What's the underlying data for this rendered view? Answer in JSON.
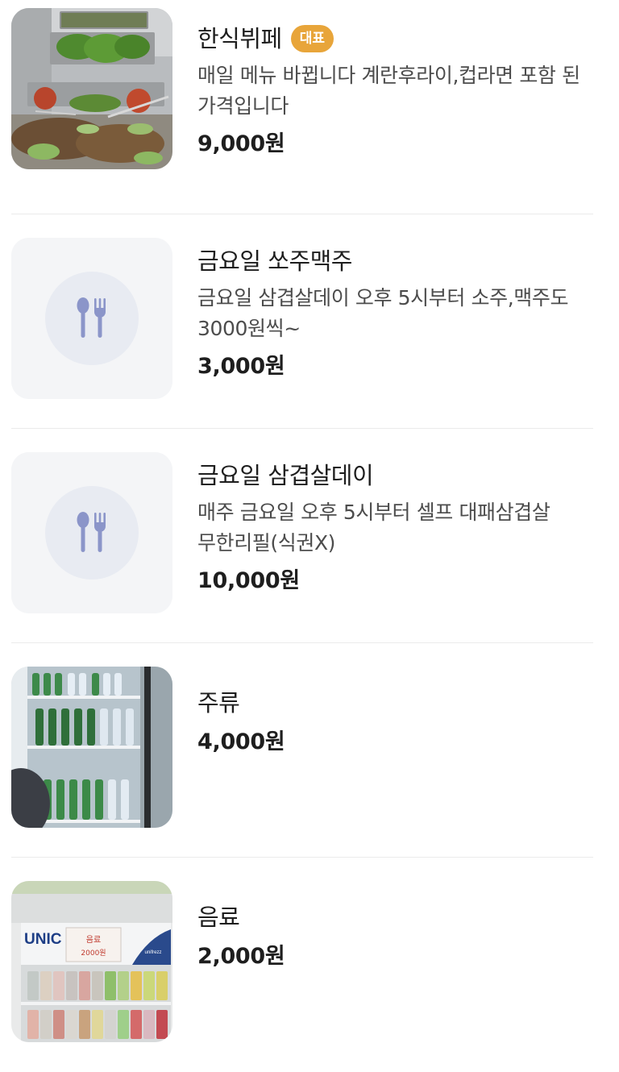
{
  "colors": {
    "badge": "#e8a53a",
    "placeholder_bg": "#f4f5f7",
    "placeholder_circle": "#e8ebf2",
    "placeholder_icon": "#8b95c9",
    "divider": "#ebebeb",
    "price_text": "#1e1e1e",
    "desc_text": "#4c4c4c"
  },
  "menu": {
    "items": [
      {
        "name": "한식뷔페",
        "badge": "대표",
        "description": "매일 메뉴 바뀝니다 계란후라이,컵라면 포함 된 가격입니다",
        "price": "9,000원",
        "image": "buffet-photo"
      },
      {
        "name": "금요일 쏘주맥주",
        "description": "금요일 삼겹살데이 오후 5시부터 소주,맥주도 3000원씩~",
        "price": "3,000원",
        "image": "utensils-placeholder-icon"
      },
      {
        "name": "금요일 삼겹살데이",
        "description": "매주 금요일 오후 5시부터 셀프 대패삼겹살 무한리필(식권X)",
        "price": "10,000원",
        "image": "utensils-placeholder-icon"
      },
      {
        "name": "주류",
        "price": "4,000원",
        "image": "liquor-fridge-photo"
      },
      {
        "name": "음료",
        "price": "2,000원",
        "image": "drink-fridge-photo",
        "photo_text": {
          "brand": "UNIC",
          "sign_line1": "음료",
          "sign_line2": "2000원",
          "fridge_label": "unifrezz"
        }
      }
    ]
  }
}
